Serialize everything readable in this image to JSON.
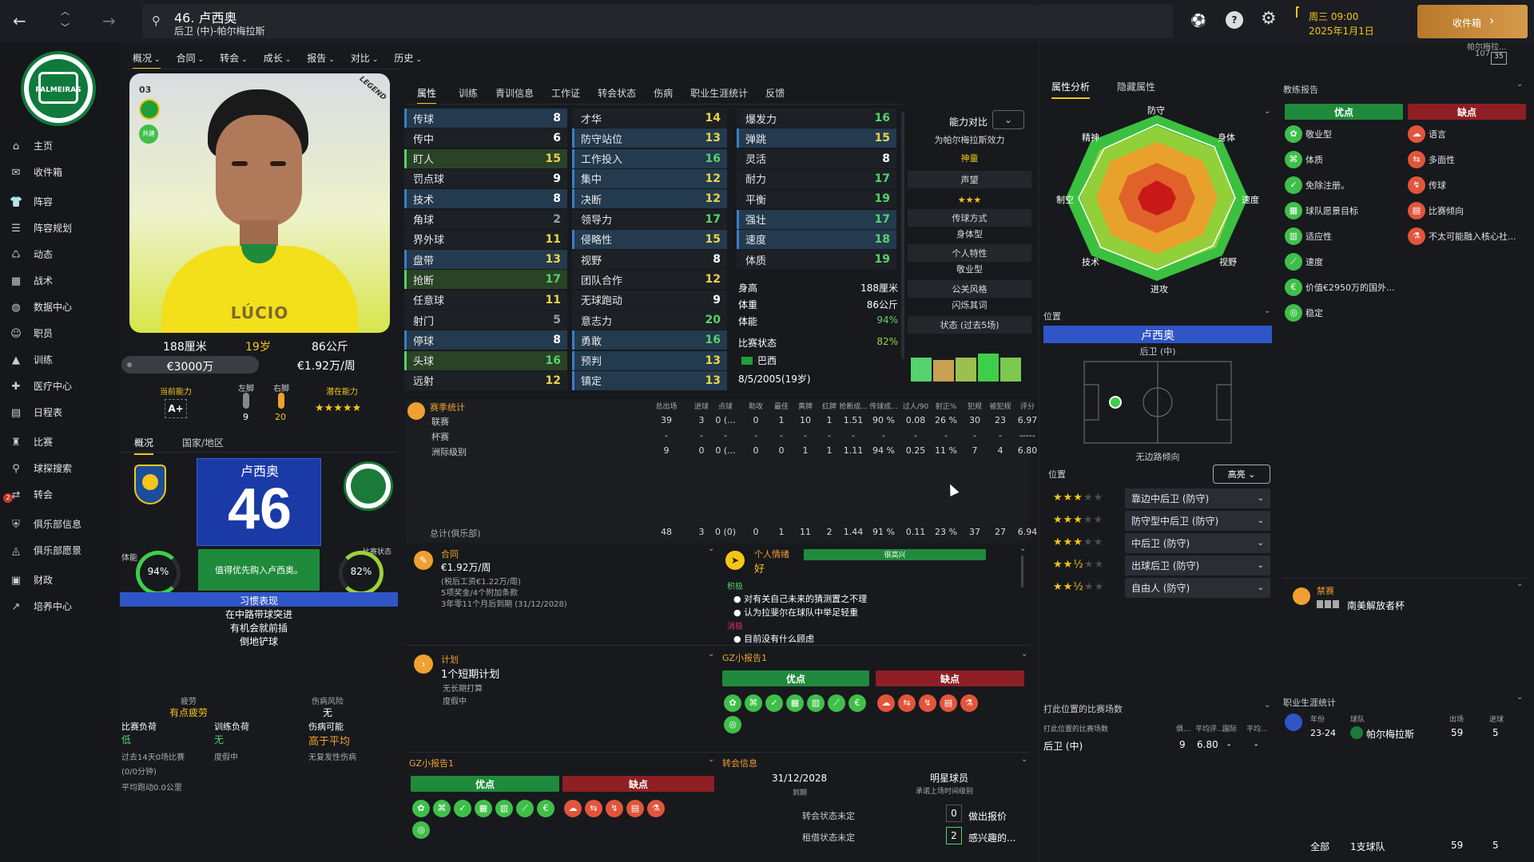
{
  "topbar": {
    "player_title": "46. 卢西奥",
    "player_sub": "后卫 (中)-帕尔梅拉斯",
    "date_line1": "周三 09:00",
    "date_line2": "2025年1月1日",
    "inbox_label": "收件箱",
    "inbox_sub": "帕尔梅拉...",
    "inbox_count": "107",
    "inbox_badge": "35"
  },
  "sidebar": {
    "logo_text": "PALMEIRAS",
    "items": [
      {
        "label": "主页",
        "icon": "home-icon"
      },
      {
        "label": "收件箱",
        "icon": "inbox-icon"
      },
      {
        "label": "阵容",
        "icon": "shirt-icon"
      },
      {
        "label": "阵容规划",
        "icon": "clipboard-icon"
      },
      {
        "label": "动态",
        "icon": "dynamics-icon"
      },
      {
        "label": "战术",
        "icon": "tactics-icon"
      },
      {
        "label": "数据中心",
        "icon": "data-icon"
      },
      {
        "label": "职员",
        "icon": "staff-icon"
      },
      {
        "label": "训练",
        "icon": "training-icon"
      },
      {
        "label": "医疗中心",
        "icon": "medical-icon"
      },
      {
        "label": "日程表",
        "icon": "calendar-icon"
      },
      {
        "label": "比赛",
        "icon": "trophy-icon"
      },
      {
        "label": "球探搜索",
        "icon": "search-icon"
      },
      {
        "label": "转会",
        "icon": "transfer-icon"
      },
      {
        "label": "俱乐部信息",
        "icon": "shield-icon"
      },
      {
        "label": "俱乐部愿景",
        "icon": "vision-icon"
      },
      {
        "label": "财政",
        "icon": "finance-icon"
      },
      {
        "label": "培养中心",
        "icon": "development-icon"
      }
    ],
    "transfer_badge": "2"
  },
  "menu": [
    "概况",
    "合同",
    "转会",
    "成长",
    "报告",
    "对比",
    "历史"
  ],
  "card": {
    "number": "03",
    "loan_badge": "共建",
    "name_on_card": "LÚCIO",
    "brand": "LEGEND",
    "height": "188厘米",
    "age": "19岁",
    "weight": "86公斤",
    "value": "€3000万",
    "wage": "€1.92万/周",
    "current_ability_label": "当前能力",
    "current_ability": "A+",
    "left_foot_label": "左脚",
    "left_foot": "9",
    "right_foot_label": "右脚",
    "right_foot": "20",
    "potential_label": "潜在能力",
    "potential_stars": "★★★★★"
  },
  "subtabs": [
    "概况",
    "国家/地区"
  ],
  "shirt": {
    "name": "卢西奥",
    "number": "46",
    "fitness_label": "体能",
    "fitness": "94%",
    "form_label": "比赛状态",
    "form": "82%",
    "note": "值得优先购入卢西奥。",
    "habits_title": "习惯表现",
    "habits": [
      "在中路带球突进",
      "有机会就前插",
      "倒地铲球"
    ]
  },
  "load": {
    "fatigue_label": "疲劳",
    "fatigue": "有点疲劳",
    "injury_risk_label": "伤病风险",
    "injury_risk": "无",
    "match_load_label": "比赛负荷",
    "match_load": "低",
    "train_load_label": "训练负荷",
    "train_load": "无",
    "injury_chance_label": "伤病可能",
    "injury_chance": "高于平均",
    "l1": "过去14天0场比赛",
    "l2": "(0/0分钟)",
    "l3": "度假中",
    "l4": "无复发性伤病",
    "l5": "平均跑动0.0公里"
  },
  "tabs": [
    "属性",
    "训练",
    "青训信息",
    "工作证",
    "转会状态",
    "伤病",
    "职业生涯统计",
    "反馈"
  ],
  "attributes": {
    "col1": [
      {
        "name": "传球",
        "value": "8",
        "hl": "b"
      },
      {
        "name": "传中",
        "value": "6",
        "hl": ""
      },
      {
        "name": "盯人",
        "value": "15",
        "hl": "g"
      },
      {
        "name": "罚点球",
        "value": "9",
        "hl": ""
      },
      {
        "name": "技术",
        "value": "8",
        "hl": "b"
      },
      {
        "name": "角球",
        "value": "2",
        "hl": ""
      },
      {
        "name": "界外球",
        "value": "11",
        "hl": ""
      },
      {
        "name": "盘带",
        "value": "13",
        "hl": "b"
      },
      {
        "name": "抢断",
        "value": "17",
        "hl": "g"
      },
      {
        "name": "任意球",
        "value": "11",
        "hl": ""
      },
      {
        "name": "射门",
        "value": "5",
        "hl": ""
      },
      {
        "name": "停球",
        "value": "8",
        "hl": "b"
      },
      {
        "name": "头球",
        "value": "16",
        "hl": "g"
      },
      {
        "name": "远射",
        "value": "12",
        "hl": ""
      }
    ],
    "col2": [
      {
        "name": "才华",
        "value": "14",
        "hl": ""
      },
      {
        "name": "防守站位",
        "value": "13",
        "hl": "b"
      },
      {
        "name": "工作投入",
        "value": "16",
        "hl": "b"
      },
      {
        "name": "集中",
        "value": "12",
        "hl": "b"
      },
      {
        "name": "决断",
        "value": "12",
        "hl": "b"
      },
      {
        "name": "领导力",
        "value": "17",
        "hl": ""
      },
      {
        "name": "侵略性",
        "value": "15",
        "hl": "b"
      },
      {
        "name": "视野",
        "value": "8",
        "hl": ""
      },
      {
        "name": "团队合作",
        "value": "12",
        "hl": ""
      },
      {
        "name": "无球跑动",
        "value": "9",
        "hl": ""
      },
      {
        "name": "意志力",
        "value": "20",
        "hl": ""
      },
      {
        "name": "勇敢",
        "value": "16",
        "hl": "b"
      },
      {
        "name": "预判",
        "value": "13",
        "hl": "b"
      },
      {
        "name": "镇定",
        "value": "13",
        "hl": "b"
      }
    ],
    "col3": [
      {
        "name": "爆发力",
        "value": "16",
        "hl": ""
      },
      {
        "name": "弹跳",
        "value": "15",
        "hl": "b"
      },
      {
        "name": "灵活",
        "value": "8",
        "hl": ""
      },
      {
        "name": "耐力",
        "value": "17",
        "hl": ""
      },
      {
        "name": "平衡",
        "value": "19",
        "hl": ""
      },
      {
        "name": "强壮",
        "value": "17",
        "hl": "b"
      },
      {
        "name": "速度",
        "value": "18",
        "hl": "b"
      },
      {
        "name": "体质",
        "value": "19",
        "hl": ""
      }
    ]
  },
  "info": {
    "height_label": "身高",
    "height": "188厘米",
    "weight_label": "体重",
    "weight": "86公斤",
    "fitness_label": "体能",
    "fitness": "94%",
    "form_label": "比赛状态",
    "form": "82%",
    "nation": "巴西",
    "dob": "8/5/2005(19岁)"
  },
  "compare": {
    "label": "能力对比",
    "club": "为帕尔梅拉斯效力",
    "club_value": "神童",
    "rep_label": "声望",
    "rep_stars": "★★★",
    "pass_label": "传球方式",
    "pass_value": "身体型",
    "trait_label": "个人特性",
    "trait_value": "敬业型",
    "pub_label": "公关风格",
    "pub_value": "闪烁其词",
    "form5_label": "状态 (过去5场)"
  },
  "stats": {
    "title": "赛季统计",
    "headers": [
      "总出场",
      "进球",
      "点球",
      "助攻",
      "最佳",
      "黄牌",
      "红牌",
      "抢断成...",
      "传球成...",
      "过人/90",
      "射正%",
      "犯规",
      "被犯规",
      "评分"
    ],
    "rows": [
      {
        "label": "联赛",
        "v": [
          "39",
          "3",
          "0 (...",
          "0",
          "1",
          "10",
          "1",
          "1.51",
          "90 %",
          "0.08",
          "26 %",
          "30",
          "23",
          "6.97"
        ]
      },
      {
        "label": "杯赛",
        "v": [
          "-",
          "-",
          "-",
          "-",
          "-",
          "-",
          "-",
          "-",
          "-",
          "-",
          "-",
          "-",
          "-",
          "-----"
        ]
      },
      {
        "label": "洲际级别",
        "v": [
          "9",
          "0",
          "0 (...",
          "0",
          "0",
          "1",
          "1",
          "1.11",
          "94 %",
          "0.25",
          "11 %",
          "7",
          "4",
          "6.80"
        ]
      }
    ],
    "total_label": "总计(俱乐部)",
    "total": [
      "48",
      "3",
      "0 (0)",
      "0",
      "1",
      "11",
      "2",
      "1.44",
      "91 %",
      "0.11",
      "23 %",
      "37",
      "27",
      "6.94"
    ]
  },
  "contract": {
    "title": "合同",
    "wage": "€1.92万/周",
    "l1": "(税后工资€1.22万/周)",
    "l2": "5项奖金/4个附加条款",
    "l3": "3年零11个月后到期 (31/12/2028)"
  },
  "mood": {
    "title": "个人情绪",
    "value": "好",
    "bar_label": "很高兴",
    "pos_label": "积极",
    "pos": [
      "对有关自己未来的猜测置之不理",
      "认为拉斐尔在球队中举足轻重"
    ],
    "neg_label": "消极",
    "neg": [
      "目前没有什么顾虑"
    ]
  },
  "plan": {
    "title": "计划",
    "main": "1个短期计划",
    "l1": "无长期打算",
    "l2": "度假中"
  },
  "gz_left": {
    "title": "GZ小报告1",
    "good": "优点",
    "bad": "缺点"
  },
  "gz_right": {
    "title": "GZ小报告1",
    "good": "优点",
    "bad": "缺点"
  },
  "transfer": {
    "title": "转会信息",
    "date": "31/12/2028",
    "date_sub": "到期",
    "star_label": "明星球员",
    "star_sub": "承诺上场时间级别",
    "r1_label": "转会状态未定",
    "r1_count": "0",
    "r1_action": "做出报价",
    "r2_label": "租借状态未定",
    "r2_count": "2",
    "r2_action": "感兴趣的..."
  },
  "analysis": {
    "tabs": [
      "属性分析",
      "隐藏属性"
    ],
    "labels": [
      "防守",
      "身体",
      "速度",
      "视野",
      "进攻",
      "技术",
      "制空",
      "精神"
    ]
  },
  "position": {
    "section": "位置",
    "name": "卢西奥",
    "role": "后卫 (中)",
    "wing": "无边路倾向",
    "list_title": "位置",
    "dropdown": "高亮",
    "roles": [
      {
        "stars": "★★★",
        "empty": "★★",
        "name": "靠边中后卫 (防守)"
      },
      {
        "stars": "★★★",
        "empty": "★★",
        "name": "防守型中后卫 (防守)"
      },
      {
        "stars": "★★★",
        "empty": "★★",
        "name": "中后卫 (防守)"
      },
      {
        "stars": "★★½",
        "empty": "★★",
        "name": "出球后卫 (防守)"
      },
      {
        "stars": "★★½",
        "empty": "★★",
        "name": "自由人 (防守)"
      }
    ]
  },
  "apps": {
    "title": "打此位置的比赛场数",
    "h1": "打此位置的比赛场数",
    "h2": "俱...",
    "h3": "平均评...",
    "h4": "国际",
    "h5": "平均...",
    "pos": "后卫 (中)",
    "v1": "9",
    "v2": "6.80",
    "v3": "-",
    "v4": "-"
  },
  "coach": {
    "title": "教练报告",
    "good": "优点",
    "bad": "缺点",
    "pros": [
      "敬业型",
      "体质",
      "免除注册。",
      "球队愿景目标",
      "适应性",
      "速度",
      "价值€2950万的国外...",
      "稳定"
    ],
    "cons": [
      "语言",
      "多面性",
      "传球",
      "比赛倾向",
      "不太可能融入核心社..."
    ]
  },
  "ban": {
    "title": "禁赛",
    "value": "南美解放者杯"
  },
  "career": {
    "title": "职业生涯统计",
    "h_year": "年份",
    "h_team": "球队",
    "h_apps": "出场",
    "h_goals": "进球",
    "year": "23-24",
    "team": "帕尔梅拉斯",
    "apps": "59",
    "goals": "5",
    "all_label": "全部",
    "all_team": "1支球队",
    "all_apps": "59",
    "all_goals": "5"
  },
  "form5": [
    0.6,
    0.55,
    0.6,
    0.7,
    0.6
  ],
  "colors": {
    "accent": "#f5c518",
    "green": "#54d36c",
    "red": "#8e1f24",
    "blue": "#2f55c7"
  }
}
